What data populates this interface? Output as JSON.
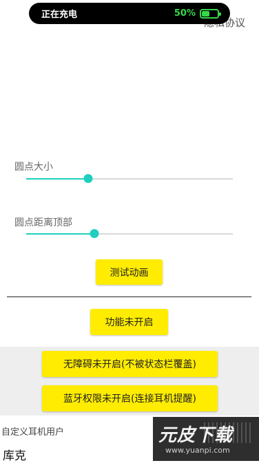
{
  "status_pill": {
    "charging_text": "正在充电",
    "battery_percent_text": "50%",
    "battery_level": 0.5
  },
  "header": {
    "privacy_text": "隐私协议"
  },
  "sliders": [
    {
      "label": "圆点大小",
      "value": 0.3
    },
    {
      "label": "圆点距离顶部",
      "value": 0.33
    }
  ],
  "buttons": {
    "test_animation": "测试动画",
    "feature_status": "功能未开启",
    "accessibility_status": "无障碍未开启(不被状态栏覆盖)",
    "bluetooth_status": "蓝牙权限未开启(连接耳机提醒)"
  },
  "custom_user": {
    "section_label": "自定义耳机用户",
    "name": "库克"
  },
  "watermark": {
    "logo_text": "元皮下载",
    "url_text": "www.yuanpi.com"
  },
  "colors": {
    "accent": "#1fcfbe",
    "button_yellow": "#ffec00",
    "battery_green": "#36d74b"
  }
}
